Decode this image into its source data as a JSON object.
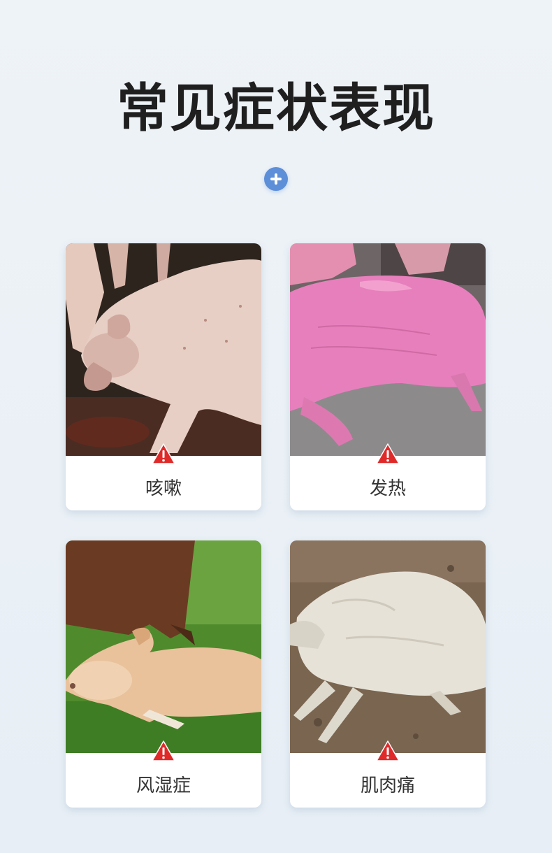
{
  "page": {
    "title": "常见症状表现",
    "plus_icon": "plus-circle-icon",
    "accent_color": "#5d8fd9",
    "warning_color": "#e02a2a"
  },
  "symptoms": [
    {
      "label": "咳嗽",
      "photo": "coughing-pig-photo"
    },
    {
      "label": "发热",
      "photo": "feverish-pink-piglet-photo"
    },
    {
      "label": "风湿症",
      "photo": "lying-calf-photo"
    },
    {
      "label": "肌肉痛",
      "photo": "lying-sheep-photo"
    }
  ]
}
